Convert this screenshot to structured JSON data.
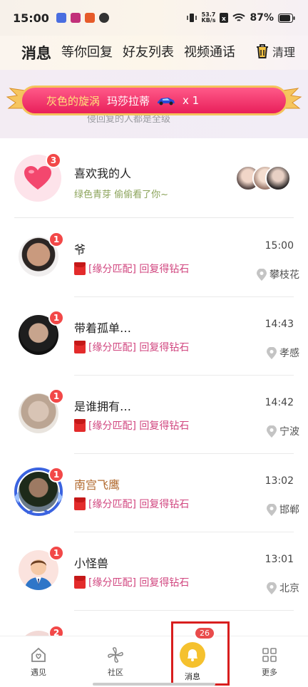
{
  "status_bar": {
    "time": "15:00",
    "net_speed_value": "53.7",
    "net_speed_unit": "KB/s",
    "battery": "87%"
  },
  "tabs": [
    {
      "label": "消息",
      "active": true
    },
    {
      "label": "等你回复",
      "active": false
    },
    {
      "label": "好友列表",
      "active": false
    },
    {
      "label": "视频通话",
      "active": false
    }
  ],
  "clean_label": "清理",
  "banner": {
    "user": "灰色的旋涡",
    "gift": "玛莎拉蒂",
    "count": "x 1",
    "subtitle": "侵回复的人都是全级"
  },
  "likes": {
    "title": "喜欢我的人",
    "subtitle": "绿色青芽 偷偷看了你~",
    "badge": "3"
  },
  "messages": [
    {
      "name": "爷",
      "snippet": "[缘分匹配] 回复得钻石",
      "time": "15:00",
      "location": "攀枝花",
      "badge": "1",
      "vip": false
    },
    {
      "name": "带着孤单…",
      "snippet": "[缘分匹配] 回复得钻石",
      "time": "14:43",
      "location": "孝感",
      "badge": "1",
      "vip": false
    },
    {
      "name": "是谁拥有…",
      "snippet": "[缘分匹配] 回复得钻石",
      "time": "14:42",
      "location": "宁波",
      "badge": "1",
      "vip": false
    },
    {
      "name": "南宫飞鹰",
      "snippet": "[缘分匹配] 回复得钻石",
      "time": "13:02",
      "location": "邯郸",
      "badge": "1",
      "vip": true
    },
    {
      "name": "小怪兽",
      "snippet": "[缘分匹配] 回复得钻石",
      "time": "13:01",
      "location": "北京",
      "badge": "1",
      "vip": false
    }
  ],
  "partial_badge": "2",
  "bottom_nav": [
    {
      "label": "遇见",
      "icon": "home-heart-icon"
    },
    {
      "label": "社区",
      "icon": "pinwheel-icon"
    },
    {
      "label": "消息",
      "icon": "bell-icon",
      "badge": "26",
      "active": true
    },
    {
      "label": "更多",
      "icon": "grid-icon"
    }
  ],
  "colors": {
    "accent": "#f3b54a",
    "badge": "#f24848",
    "snippet": "#d1467f",
    "ribbon": "#e81f5a",
    "highlight": "#d81e1e"
  }
}
